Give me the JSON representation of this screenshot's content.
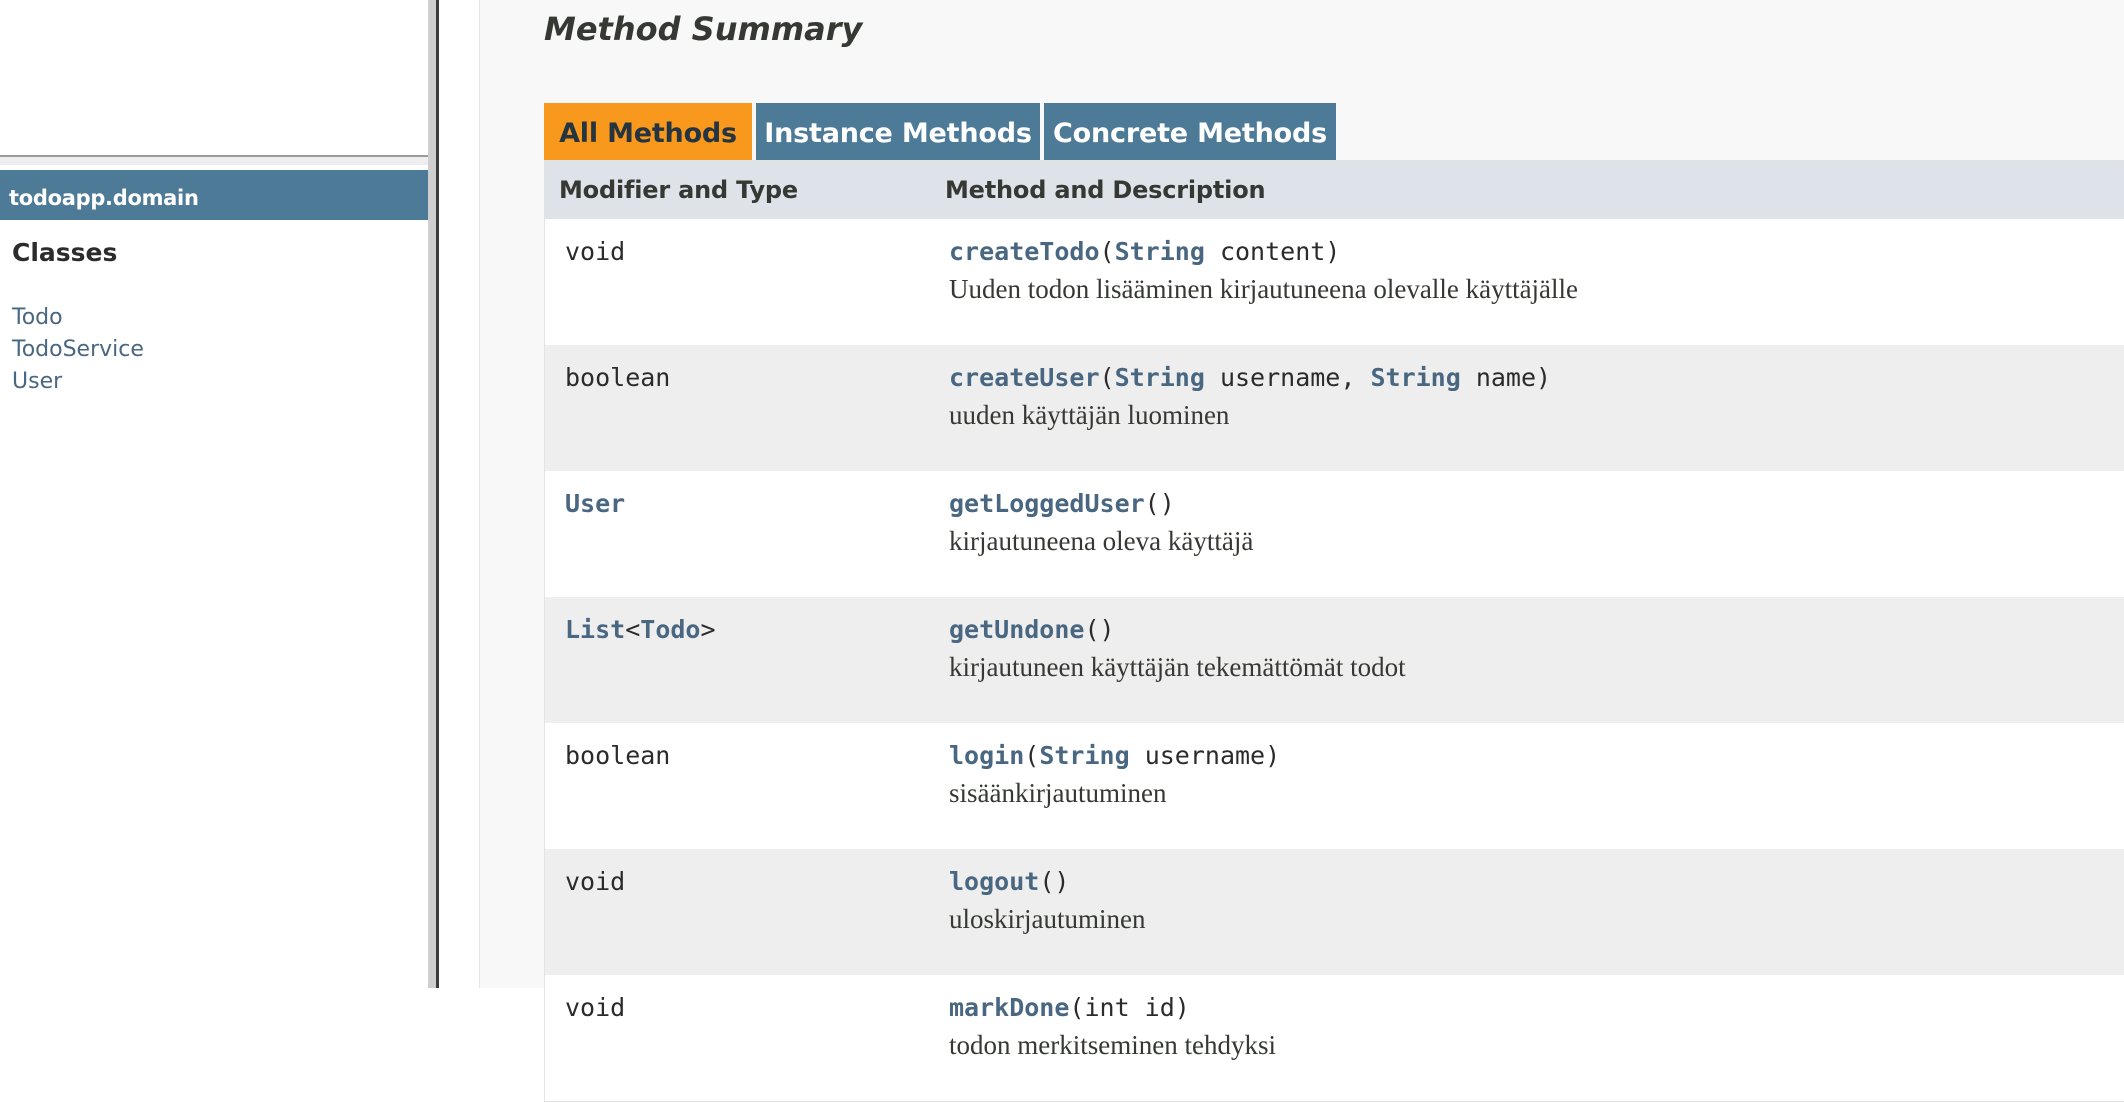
{
  "left": {
    "package_name": "todoapp.domain",
    "classes_heading": "Classes",
    "classes": [
      "Todo",
      "TodoService",
      "User"
    ]
  },
  "main": {
    "section_title": "Method Summary",
    "tabs": [
      {
        "label": "All Methods",
        "active": true
      },
      {
        "label": "Instance Methods",
        "active": false
      },
      {
        "label": "Concrete Methods",
        "active": false
      }
    ],
    "table": {
      "headers": [
        "Modifier and Type",
        "Method and Description"
      ],
      "rows": [
        {
          "type": "void",
          "method": "createTodo",
          "open": "(",
          "param_type": "String",
          "params": " content)",
          "description": "Uuden todon lisääminen kirjautuneena olevalle käyttäjälle"
        },
        {
          "type": "boolean",
          "method": "createUser",
          "open": "(",
          "param_type": "String",
          "params_a": " username, ",
          "param_type_b": "String",
          "params_b": " name)",
          "description": "uuden käyttäjän luominen"
        },
        {
          "type_link": "User",
          "method": "getLoggedUser",
          "params": "()",
          "description": "kirjautuneena oleva käyttäjä"
        },
        {
          "type_link": "List",
          "type_lt": "<",
          "type_generic": "Todo",
          "type_gt": ">",
          "method": "getUndone",
          "params": "()",
          "description": "kirjautuneen käyttäjän tekemättömät todot"
        },
        {
          "type": "boolean",
          "method": "login",
          "open": "(",
          "param_type": "String",
          "params": " username)",
          "description": "sisäänkirjautuminen"
        },
        {
          "type": "void",
          "method": "logout",
          "params": "()",
          "description": "uloskirjautuminen"
        },
        {
          "type": "void",
          "method": "markDone",
          "params": "(int id)",
          "description": "todon merkitseminen tehdyksi"
        }
      ]
    }
  },
  "colors": {
    "tab_active": "#f8981d",
    "tab_inactive": "#4d7a97",
    "link": "#4a6782",
    "header_bg": "#dee3e9"
  }
}
